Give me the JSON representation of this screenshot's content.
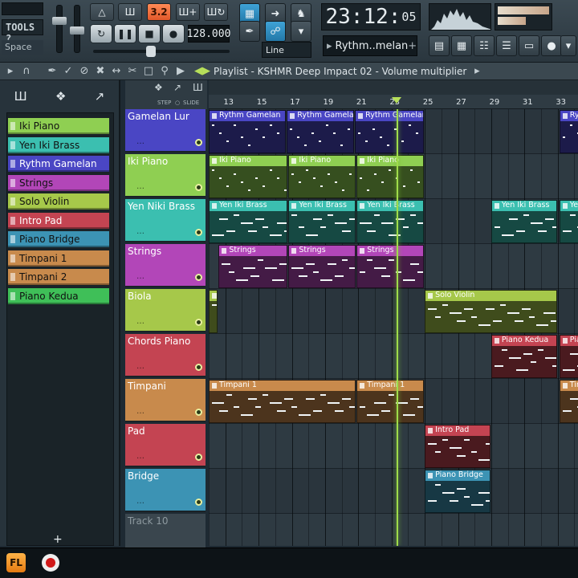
{
  "toolbar": {
    "tools_label": "TOOLS ?",
    "space_label": "Space",
    "pattern_value": "3.2",
    "tempo": "128.000",
    "clock_main": "23:12:",
    "clock_small": "05",
    "pattern_name": "Rythm..melan",
    "snap_label": "Line",
    "icons": [
      "metronome-icon",
      "loop-icon",
      "typing-keyboard-icon",
      "step-icon",
      "play-icon",
      "stop-icon",
      "record-icon"
    ]
  },
  "playlist": {
    "title": "Playlist - KSHMR Deep Impact 02 - Volume multiplier",
    "step_label": "STEP",
    "slide_label": "SLIDE"
  },
  "picker": {
    "items": [
      {
        "label": "Iki Piano",
        "color": "#8fcf52"
      },
      {
        "label": "Yen Iki Brass",
        "color": "#3bbfb0"
      },
      {
        "label": "Rythm Gamelan",
        "color": "#4a46c4"
      },
      {
        "label": "Strings",
        "color": "#b246b8"
      },
      {
        "label": "Solo Violin",
        "color": "#a6c84a"
      },
      {
        "label": "Intro Pad",
        "color": "#c44452"
      },
      {
        "label": "Piano Bridge",
        "color": "#3c93b4"
      },
      {
        "label": "Timpani 1",
        "color": "#c88a4c"
      },
      {
        "label": "Timpani 2",
        "color": "#c88a4c"
      },
      {
        "label": "Piano Kedua",
        "color": "#3fbf58"
      }
    ]
  },
  "tracks": [
    {
      "name": "Gamelan Lur",
      "color": "#4a46c4"
    },
    {
      "name": "Iki Piano",
      "color": "#8fcf52"
    },
    {
      "name": "Yen Niki Brass",
      "color": "#3bbfb0"
    },
    {
      "name": "Strings",
      "color": "#b246b8"
    },
    {
      "name": "Biola",
      "color": "#a6c84a"
    },
    {
      "name": "Chords Piano",
      "color": "#c44452"
    },
    {
      "name": "Timpani",
      "color": "#c88a4c"
    },
    {
      "name": "Pad",
      "color": "#c44452"
    },
    {
      "name": "Bridge",
      "color": "#3c93b4"
    },
    {
      "name": "Track 10",
      "color": "#3a464e"
    }
  ],
  "timeline": {
    "bars": [
      "13",
      "15",
      "17",
      "19",
      "21",
      "23",
      "25",
      "27",
      "29",
      "31",
      "33"
    ],
    "playhead_bar": 23.3
  },
  "clips": [
    {
      "lane": 0,
      "start": 12,
      "len": 4.7,
      "label": "Rythm Gamelan",
      "color": "#4a46c4"
    },
    {
      "lane": 0,
      "start": 16.7,
      "len": 4.1,
      "label": "Rythm Gamelan",
      "color": "#4a46c4"
    },
    {
      "lane": 0,
      "start": 20.8,
      "len": 4.2,
      "label": "Rythm Gamelan",
      "color": "#4a46c4"
    },
    {
      "lane": 0,
      "start": 33.1,
      "len": 2,
      "label": "Rythm",
      "color": "#4a46c4"
    },
    {
      "lane": 1,
      "start": 12,
      "len": 4.8,
      "label": "Iki Piano",
      "color": "#8fcf52"
    },
    {
      "lane": 1,
      "start": 16.8,
      "len": 4.1,
      "label": "Iki Piano",
      "color": "#8fcf52"
    },
    {
      "lane": 1,
      "start": 20.9,
      "len": 4.1,
      "label": "Iki Piano",
      "color": "#8fcf52"
    },
    {
      "lane": 2,
      "start": 12,
      "len": 4.8,
      "label": "Yen Iki Brass",
      "color": "#3bbfb0"
    },
    {
      "lane": 2,
      "start": 16.8,
      "len": 4.1,
      "label": "Yen Iki Brass",
      "color": "#3bbfb0"
    },
    {
      "lane": 2,
      "start": 20.9,
      "len": 4.1,
      "label": "Yen Iki Brass",
      "color": "#3bbfb0"
    },
    {
      "lane": 2,
      "start": 29,
      "len": 4,
      "label": "Yen Iki Brass",
      "color": "#3bbfb0"
    },
    {
      "lane": 2,
      "start": 33.1,
      "len": 2,
      "label": "Yen Iki",
      "color": "#3bbfb0"
    },
    {
      "lane": 3,
      "start": 12.6,
      "len": 4.2,
      "label": "Strings",
      "color": "#b246b8"
    },
    {
      "lane": 3,
      "start": 16.8,
      "len": 4.1,
      "label": "Strings",
      "color": "#b246b8"
    },
    {
      "lane": 3,
      "start": 20.9,
      "len": 4.1,
      "label": "Strings",
      "color": "#b246b8"
    },
    {
      "lane": 4,
      "start": 12,
      "len": 0.6,
      "label": "",
      "color": "#a6c84a"
    },
    {
      "lane": 4,
      "start": 25,
      "len": 8,
      "label": "Solo Violin",
      "color": "#a6c84a"
    },
    {
      "lane": 5,
      "start": 29,
      "len": 4,
      "label": "Piano Kedua",
      "color": "#c44452"
    },
    {
      "lane": 5,
      "start": 33.1,
      "len": 2,
      "label": "Piano",
      "color": "#c44452"
    },
    {
      "lane": 6,
      "start": 12,
      "len": 8.9,
      "label": "Timpani 1",
      "color": "#c88a4c"
    },
    {
      "lane": 6,
      "start": 20.9,
      "len": 4.1,
      "label": "Timpani 1",
      "color": "#c88a4c"
    },
    {
      "lane": 6,
      "start": 33.1,
      "len": 2,
      "label": "Timp",
      "color": "#c88a4c"
    },
    {
      "lane": 7,
      "start": 25,
      "len": 4,
      "label": "Intro Pad",
      "color": "#c44452"
    },
    {
      "lane": 8,
      "start": 25,
      "len": 4,
      "label": "Piano Bridge",
      "color": "#3c93b4"
    }
  ]
}
